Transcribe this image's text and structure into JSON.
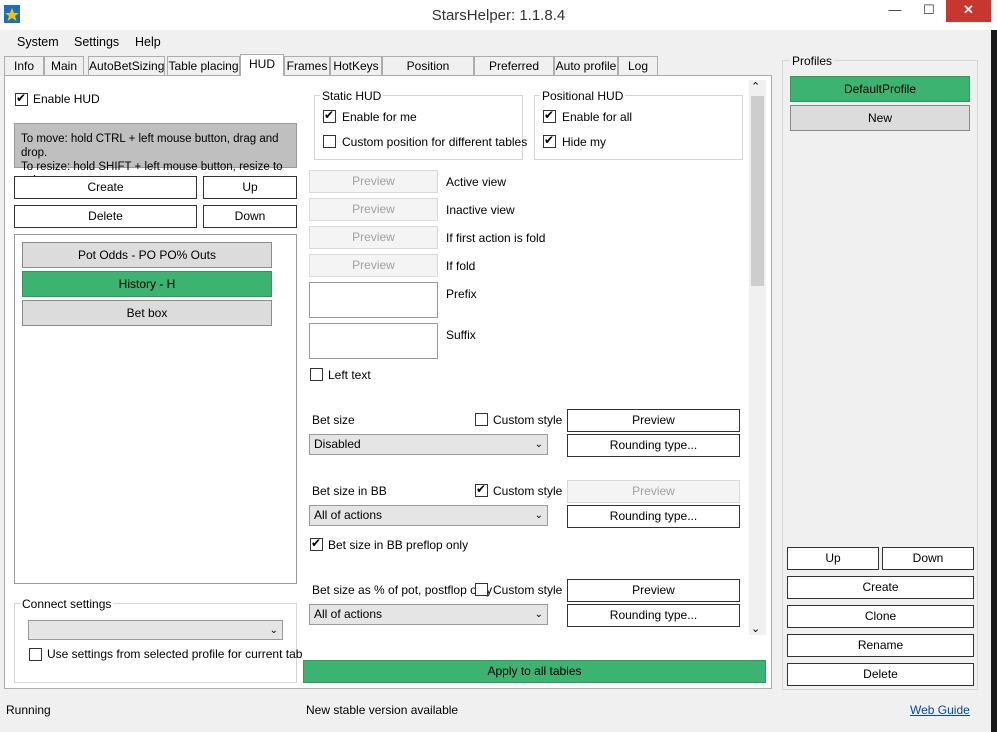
{
  "window": {
    "title": "StarsHelper: 1.1.8.4",
    "min": "—",
    "max": "☐",
    "close": "✕"
  },
  "menu": [
    "System",
    "Settings",
    "Help"
  ],
  "tabs": [
    "Info",
    "Main",
    "AutoBetSizing",
    "Table placing",
    "HUD",
    "Frames",
    "HotKeys",
    "Position template",
    "Preferred Seat",
    "Auto profile",
    "Log"
  ],
  "active_tab": "HUD",
  "hud": {
    "enable_hud": "Enable HUD",
    "hint_line1": "To move: hold CTRL + left mouse button, drag and drop.",
    "hint_line2": "To resize: hold SHIFT + left mouse button, resize to suit.",
    "create": "Create",
    "up": "Up",
    "delete": "Delete",
    "down": "Down",
    "items": [
      "Pot Odds - PO PO% Outs",
      "History - H",
      "Bet box"
    ],
    "connect_settings": "Connect settings",
    "use_settings_label": "Use settings from selected profile for current tab"
  },
  "static_hud": {
    "title": "Static HUD",
    "enable_for_me": "Enable for me",
    "custom_position": "Custom position for different tables"
  },
  "positional_hud": {
    "title": "Positional HUD",
    "enable_for_all": "Enable for all",
    "hide_my": "Hide my"
  },
  "views": {
    "preview": "Preview",
    "active_view": "Active view",
    "inactive_view": "Inactive view",
    "if_first_fold": "If first action is fold",
    "if_fold": "If fold",
    "prefix": "Prefix",
    "suffix": "Suffix",
    "left_text": "Left text"
  },
  "bet": {
    "custom_style": "Custom style",
    "preview": "Preview",
    "rounding": "Rounding type...",
    "bet_size": "Bet size",
    "bet_size_value": "Disabled",
    "bet_size_bb": "Bet size in BB",
    "bet_size_bb_value": "All of actions",
    "bb_preflop_only": "Bet size in BB preflop only",
    "bet_pct": "Bet size as % of pot, postflop only",
    "bet_pct_value": "All of actions"
  },
  "apply_all": "Apply to all tables",
  "profiles": {
    "title": "Profiles",
    "items": [
      "DefaultProfile",
      "New"
    ],
    "up": "Up",
    "down": "Down",
    "create": "Create",
    "clone": "Clone",
    "rename": "Rename",
    "delete": "Delete"
  },
  "status": {
    "state": "Running",
    "message": "New stable version available",
    "web_guide": "Web Guide"
  },
  "colors": {
    "accent_green": "#3cb371",
    "close_red": "#c7372f"
  }
}
